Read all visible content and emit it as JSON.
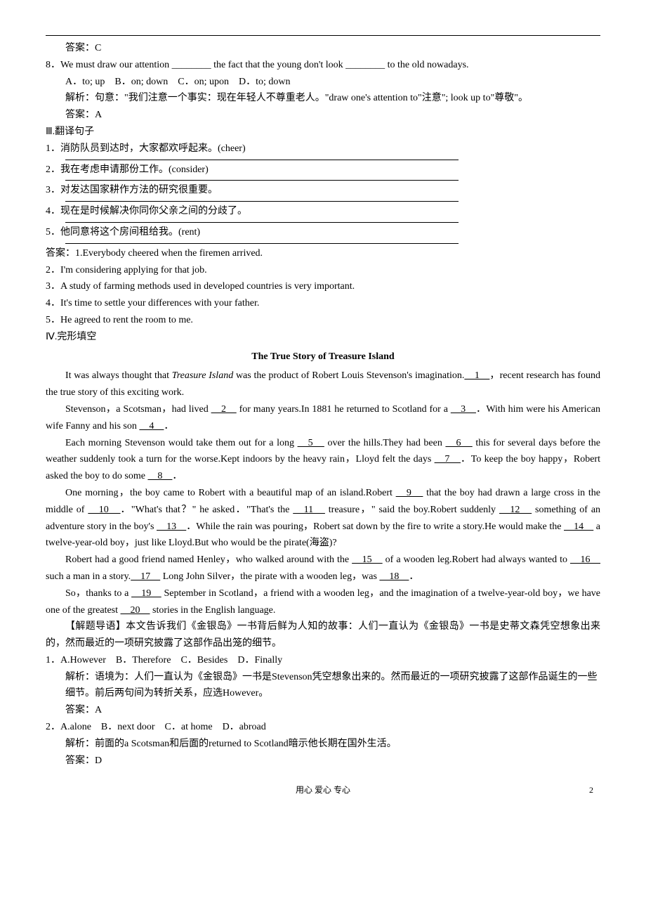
{
  "q_answer_c": "答案：C",
  "q8": {
    "text": "8．We must draw our attention ________ the fact that the young don't look ________ to the old nowadays.",
    "opts": "A．to; up　B．on; down　C．on; upon　D．to; down",
    "explain": "解析：句意：\"我们注意一个事实：现在年轻人不尊重老人。\"draw one's attention to\"注意\"; look up to\"尊敬\"。",
    "answer": "答案：A"
  },
  "section3": "Ⅲ.翻译句子",
  "t1": "1．消防队员到达时，大家都欢呼起来。(cheer)",
  "t2": "2．我在考虑申请那份工作。(consider)",
  "t3": "3．对发达国家耕作方法的研究很重要。",
  "t4": "4．现在是时候解决你同你父亲之间的分歧了。",
  "t5": "5．他同意将这个房间租给我。(rent)",
  "ans_label": "答案：1.Everybody cheered when the firemen arrived.",
  "ans2": "2．I'm considering applying for that job.",
  "ans3": "3．A study of farming methods used in developed countries is very important.",
  "ans4": "4．It's time to settle your differences with your father.",
  "ans5": "5．He agreed to rent the room to me.",
  "section4": "Ⅳ.完形填空",
  "passage_title": "The True Story of Treasure Island",
  "p1a": "It was always thought that ",
  "p1_italic": "Treasure Island",
  "p1b": " was the product of Robert Louis Stevenson's imagination.",
  "p1c": "，recent research has found the true story of this exciting work.",
  "p2a": "Stevenson，a Scotsman，had lived ",
  "p2b": " for many years.In 1881 he returned to Scotland for a ",
  "p2c": "．With him were his American wife Fanny and his son ",
  "p2d": "．",
  "p3a": "Each morning Stevenson would take them out for a long ",
  "p3b": " over the hills.They had been ",
  "p3c": " this for several days before the weather suddenly took a turn for the worse.Kept indoors by the heavy rain，Lloyd felt the days ",
  "p3d": "．To keep the boy happy，Robert asked the boy to do some ",
  "p3e": "．",
  "p4a": "One morning，the boy came to Robert with a beautiful map of an island.Robert ",
  "p4b": " that the boy had drawn a large cross in the middle of ",
  "p4c": "．\"What's that？\" he asked．\"That's the ",
  "p4d": " treasure，\" said the boy.Robert suddenly ",
  "p4e": " something of an adventure story in the boy's ",
  "p4f": "．While the rain was pouring，Robert sat down by the fire to write a story.He would make the ",
  "p4g": " a twelve-year-old boy，just like Lloyd.But who would be the pirate(海盗)?",
  "p5a": "Robert had a good friend named Henley，who walked around with the ",
  "p5b": " of a wooden leg.Robert had always wanted to ",
  "p5c": " such a man in a story.",
  "p5d": " Long John Silver，the pirate with a wooden leg，was ",
  "p5e": "．",
  "p6a": "So，thanks to a ",
  "p6b": " September in Scotland，a friend with a wooden leg，and the imagination of a twelve-year-old boy，we have one of the greatest ",
  "p6c": " stories in the English language.",
  "guide": "【解题导语】本文告诉我们《金银岛》一书背后鲜为人知的故事：人们一直认为《金银岛》一书是史蒂文森凭空想象出来的，然而最近的一项研究披露了这部作品出笼的细节。",
  "c1": {
    "opts": "1．A.However　B．Therefore　C．Besides　D．Finally",
    "explain": "解析：语境为：人们一直认为《金银岛》一书是Stevenson凭空想象出来的。然而最近的一项研究披露了这部作品诞生的一些细节。前后两句间为转折关系，应选However。",
    "answer": "答案：A"
  },
  "c2": {
    "opts": "2．A.alone　B．next door　C．at home　D．abroad",
    "explain": "解析：前面的a Scotsman和后面的returned to Scotland暗示他长期在国外生活。",
    "answer": "答案：D"
  },
  "gaps": {
    "g1": "　1　",
    "g2": "　2　",
    "g3": "　3　",
    "g4": "　4　",
    "g5": "　5　",
    "g6": "　6　",
    "g7": "　7　",
    "g8": "　8　",
    "g9": "　9　",
    "g10": "　10　",
    "g11": "　11　",
    "g12": "　12　",
    "g13": "　13　",
    "g14": "　14　",
    "g15": "　15　",
    "g16": "　16　",
    "g17": "　17　",
    "g18": "　18　",
    "g19": "　19　",
    "g20": "　20　"
  },
  "footer": "用心 爱心 专心",
  "page": "2"
}
